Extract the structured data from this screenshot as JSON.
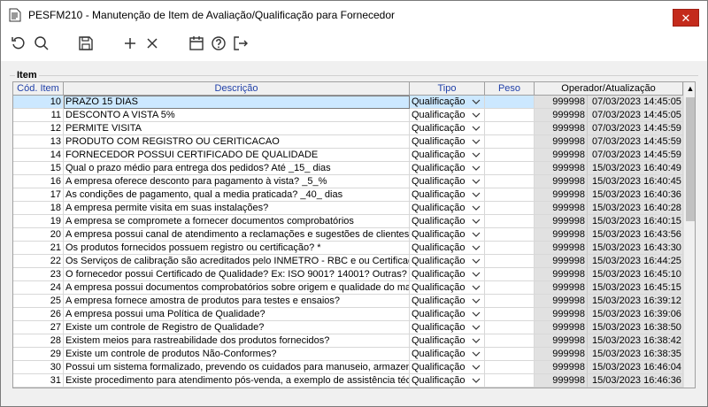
{
  "window": {
    "title": "PESFM210 - Manutenção de Item de Avaliação/Qualificação para Fornecedor",
    "close_glyph": "✕"
  },
  "toolbar": {
    "icons": [
      "refresh-icon",
      "search-icon",
      "save-icon",
      "add-icon",
      "delete-icon",
      "calendar-icon",
      "help-icon",
      "exit-icon"
    ]
  },
  "group": {
    "label": "Item"
  },
  "grid": {
    "headers": {
      "cod": "Cód. Item",
      "desc": "Descrição",
      "tipo": "Tipo",
      "peso": "Peso",
      "op": "Operador/Atualização"
    },
    "rows": [
      {
        "cod": "10",
        "desc": "PRAZO 15 DIAS",
        "tipo": "Qualificação",
        "peso": "",
        "op": "999998",
        "dt": "07/03/2023 14:45:05"
      },
      {
        "cod": "11",
        "desc": "DESCONTO A VISTA 5%",
        "tipo": "Qualificação",
        "peso": "",
        "op": "999998",
        "dt": "07/03/2023 14:45:05"
      },
      {
        "cod": "12",
        "desc": "PERMITE VISITA",
        "tipo": "Qualificação",
        "peso": "",
        "op": "999998",
        "dt": "07/03/2023 14:45:59"
      },
      {
        "cod": "13",
        "desc": "PRODUTO COM REGISTRO OU CERITICACAO",
        "tipo": "Qualificação",
        "peso": "",
        "op": "999998",
        "dt": "07/03/2023 14:45:59"
      },
      {
        "cod": "14",
        "desc": "FORNECEDOR POSSUI CERTIFICADO DE QUALIDADE",
        "tipo": "Qualificação",
        "peso": "",
        "op": "999998",
        "dt": "07/03/2023 14:45:59"
      },
      {
        "cod": "15",
        "desc": "Qual o prazo médio para entrega dos pedidos? Até _15_ dias",
        "tipo": "Qualificação",
        "peso": "",
        "op": "999998",
        "dt": "15/03/2023 16:40:49"
      },
      {
        "cod": "16",
        "desc": "A empresa oferece desconto para pagamento à vista? _5_%",
        "tipo": "Qualificação",
        "peso": "",
        "op": "999998",
        "dt": "15/03/2023 16:40:45"
      },
      {
        "cod": "17",
        "desc": "As condições de pagamento, qual a media praticada? _40_ dias",
        "tipo": "Qualificação",
        "peso": "",
        "op": "999998",
        "dt": "15/03/2023 16:40:36"
      },
      {
        "cod": "18",
        "desc": "A empresa permite visita em suas instalações?",
        "tipo": "Qualificação",
        "peso": "",
        "op": "999998",
        "dt": "15/03/2023 16:40:28"
      },
      {
        "cod": "19",
        "desc": "A empresa se compromete a fornecer documentos comprobatórios",
        "tipo": "Qualificação",
        "peso": "",
        "op": "999998",
        "dt": "15/03/2023 16:40:15"
      },
      {
        "cod": "20",
        "desc": "A empresa possui canal de atendimento a reclamações e sugestões de clientes?",
        "tipo": "Qualificação",
        "peso": "",
        "op": "999998",
        "dt": "15/03/2023 16:43:56"
      },
      {
        "cod": "21",
        "desc": "Os produtos fornecidos possuem registro ou certificação? *",
        "tipo": "Qualificação",
        "peso": "",
        "op": "999998",
        "dt": "15/03/2023 16:43:30"
      },
      {
        "cod": "22",
        "desc": "Os Serviços de calibração são acreditados pelo INMETRO - RBC e ou Certificado",
        "tipo": "Qualificação",
        "peso": "",
        "op": "999998",
        "dt": "15/03/2023 16:44:25"
      },
      {
        "cod": "23",
        "desc": "O fornecedor possui Certificado de Qualidade? Ex: ISO 9001? 14001? Outras? *",
        "tipo": "Qualificação",
        "peso": "",
        "op": "999998",
        "dt": "15/03/2023 16:45:10"
      },
      {
        "cod": "24",
        "desc": "A empresa possui documentos comprobatórios sobre origem e qualidade do material",
        "tipo": "Qualificação",
        "peso": "",
        "op": "999998",
        "dt": "15/03/2023 16:45:15"
      },
      {
        "cod": "25",
        "desc": "A empresa fornece amostra de produtos para testes e ensaios?",
        "tipo": "Qualificação",
        "peso": "",
        "op": "999998",
        "dt": "15/03/2023 16:39:12"
      },
      {
        "cod": "26",
        "desc": "A empresa possui uma Política de Qualidade?",
        "tipo": "Qualificação",
        "peso": "",
        "op": "999998",
        "dt": "15/03/2023 16:39:06"
      },
      {
        "cod": "27",
        "desc": "Existe um controle de Registro de Qualidade?",
        "tipo": "Qualificação",
        "peso": "",
        "op": "999998",
        "dt": "15/03/2023 16:38:50"
      },
      {
        "cod": "28",
        "desc": "Existem meios para rastreabilidade dos produtos fornecidos?",
        "tipo": "Qualificação",
        "peso": "",
        "op": "999998",
        "dt": "15/03/2023 16:38:42"
      },
      {
        "cod": "29",
        "desc": "Existe um controle de produtos Não-Conformes?",
        "tipo": "Qualificação",
        "peso": "",
        "op": "999998",
        "dt": "15/03/2023 16:38:35"
      },
      {
        "cod": "30",
        "desc": "Possui um sistema formalizado, prevendo os cuidados para manuseio, armazenamento",
        "tipo": "Qualificação",
        "peso": "",
        "op": "999998",
        "dt": "15/03/2023 16:46:04"
      },
      {
        "cod": "31",
        "desc": "Existe procedimento para atendimento pós-venda, a exemplo de assistência técnica",
        "tipo": "Qualificação",
        "peso": "",
        "op": "999998",
        "dt": "15/03/2023 16:46:36"
      }
    ]
  },
  "scrollbar": {
    "up_glyph": "▲"
  }
}
